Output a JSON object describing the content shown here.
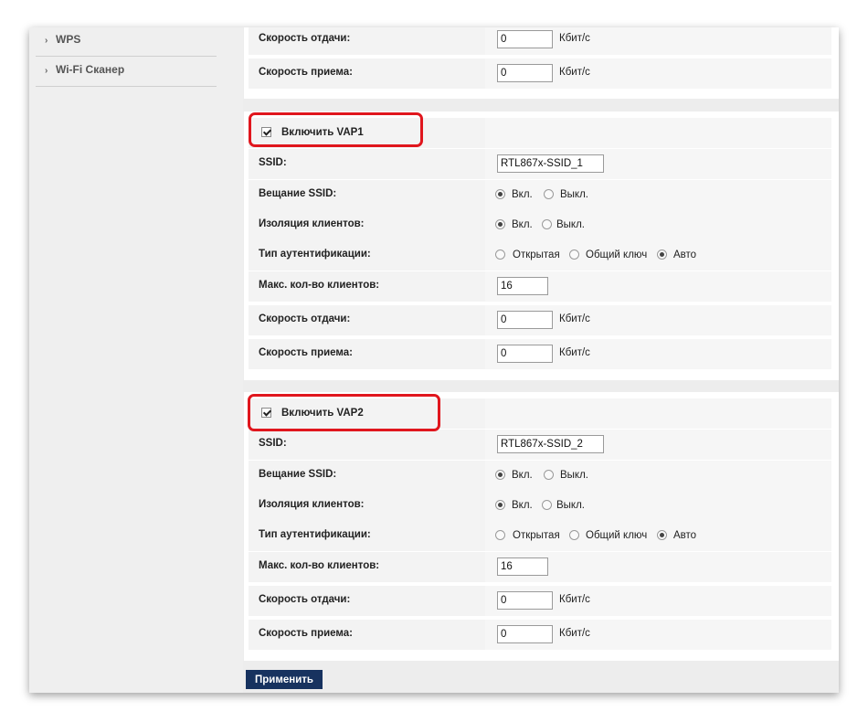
{
  "sidebar": {
    "items": [
      {
        "label": "WPS"
      },
      {
        "label": "Wi-Fi Сканер"
      }
    ]
  },
  "top": {
    "upload_label": "Скорость отдачи:",
    "upload_value": "0",
    "upload_unit": "Кбит/с",
    "download_label": "Скорость приема:",
    "download_value": "0",
    "download_unit": "Кбит/с"
  },
  "vap1": {
    "enable_label": "Включить VAP1",
    "enabled": true,
    "ssid_label": "SSID:",
    "ssid_value": "RTL867x-SSID_1",
    "broadcast_label": "Вещание SSID:",
    "broadcast_on": "Вкл.",
    "broadcast_off": "Выкл.",
    "isolation_label": "Изоляция клиентов:",
    "isolation_on": "Вкл.",
    "isolation_off": "Выкл.",
    "auth_label": "Тип аутентификации:",
    "auth_open": "Открытая",
    "auth_shared": "Общий ключ",
    "auth_auto": "Авто",
    "maxclients_label": "Макс. кол-во клиентов:",
    "maxclients_value": "16",
    "upload_label": "Скорость отдачи:",
    "upload_value": "0",
    "upload_unit": "Кбит/с",
    "download_label": "Скорость приема:",
    "download_value": "0",
    "download_unit": "Кбит/с"
  },
  "vap2": {
    "enable_label": "Включить VAP2",
    "enabled": true,
    "ssid_label": "SSID:",
    "ssid_value": "RTL867x-SSID_2",
    "broadcast_label": "Вещание SSID:",
    "broadcast_on": "Вкл.",
    "broadcast_off": "Выкл.",
    "isolation_label": "Изоляция клиентов:",
    "isolation_on": "Вкл.",
    "isolation_off": "Выкл.",
    "auth_label": "Тип аутентификации:",
    "auth_open": "Открытая",
    "auth_shared": "Общий ключ",
    "auth_auto": "Авто",
    "maxclients_label": "Макс. кол-во клиентов:",
    "maxclients_value": "16",
    "upload_label": "Скорость отдачи:",
    "upload_value": "0",
    "upload_unit": "Кбит/с",
    "download_label": "Скорость приема:",
    "download_value": "0",
    "download_unit": "Кбит/с"
  },
  "apply_label": "Применить",
  "colors": {
    "highlight": "#e0161d",
    "button_bg": "#17325f",
    "frame_bg": "#ededed"
  }
}
